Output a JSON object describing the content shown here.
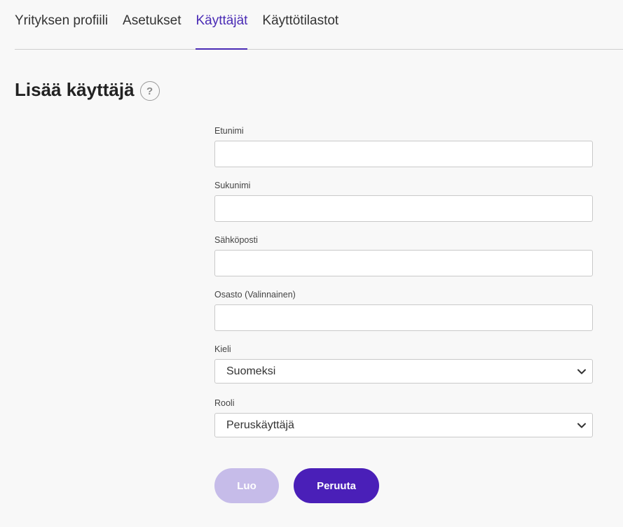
{
  "tabs": [
    {
      "label": "Yrityksen profiili",
      "active": false
    },
    {
      "label": "Asetukset",
      "active": false
    },
    {
      "label": "Käyttäjät",
      "active": true
    },
    {
      "label": "Käyttötilastot",
      "active": false
    }
  ],
  "page": {
    "title": "Lisää käyttäjä",
    "help_icon": "?"
  },
  "form": {
    "first_name": {
      "label": "Etunimi",
      "value": ""
    },
    "last_name": {
      "label": "Sukunimi",
      "value": ""
    },
    "email": {
      "label": "Sähköposti",
      "value": ""
    },
    "department": {
      "label": "Osasto (Valinnainen)",
      "value": ""
    },
    "language": {
      "label": "Kieli",
      "value": "Suomeksi"
    },
    "role": {
      "label": "Rooli",
      "value": "Peruskäyttäjä"
    }
  },
  "buttons": {
    "create_label": "Luo",
    "cancel_label": "Peruuta"
  },
  "colors": {
    "accent": "#4a2bb5",
    "create_disabled": "#c6bce9",
    "cancel": "#4a1fb8",
    "background": "#f8f8f8"
  },
  "icons": {
    "help": "help-circle-icon",
    "select_arrow": "chevron-down-icon"
  }
}
